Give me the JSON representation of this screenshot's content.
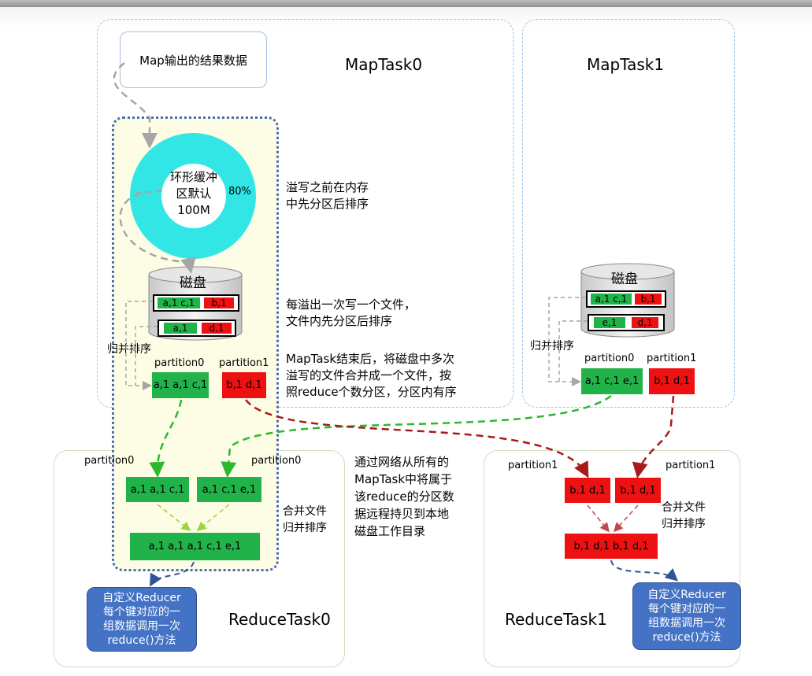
{
  "maptask0": {
    "title": "MapTask0",
    "map_output": "Map输出的结果数据",
    "ring_buffer": [
      "环形缓冲",
      "区默认",
      "100M"
    ],
    "percent": "80%",
    "spill_note": [
      "溢写之前在内存",
      "中先分区后排序"
    ],
    "disk_label": "磁盘",
    "spill_file_note": [
      "每溢出一次写一个文件，",
      "文件内先分区后排序"
    ],
    "spill1": {
      "green": "a,1 c,1",
      "red": "b,1"
    },
    "spill2": {
      "green": "a,1",
      "red": "d,1"
    },
    "merge_label": "归并排序",
    "merge_note": [
      "MapTask结束后，将磁盘中多次",
      "溢写的文件合并成一个文件，按",
      "照reduce个数分区，分区内有序"
    ],
    "p0_label": "partition0",
    "p1_label": "partition1",
    "p0_value": "a,1 a,1 c,1",
    "p1_value": "b,1 d,1"
  },
  "maptask1": {
    "title": "MapTask1",
    "disk_label": "磁盘",
    "spill1": {
      "green": "a,1 c,1",
      "red": "b,1"
    },
    "spill2": {
      "green": "e,1",
      "red": "d,1"
    },
    "merge_label": "归并排序",
    "p0_label": "partition0",
    "p1_label": "partition1",
    "p0_value": "a,1 c,1 e,1",
    "p1_value": "b,1 d,1"
  },
  "copy_note": [
    "通过网络从所有的",
    "MapTask中将属于",
    "该reduce的分区数",
    "据远程持贝到本地",
    "磁盘工作目录"
  ],
  "reducetask0": {
    "title": "ReduceTask0",
    "p_left_label": "partition0",
    "p_right_label": "partition0",
    "box_left": "a,1 a,1 c,1",
    "box_right": "a,1 c,1 e,1",
    "merged": "a,1 a,1 a,1 c,1 e,1",
    "merge_note": [
      "合并文件",
      "归并排序"
    ],
    "reducer": [
      "自定义Reducer",
      "每个键对应的一",
      "组数据调用一次",
      "reduce()方法"
    ]
  },
  "reducetask1": {
    "title": "ReduceTask1",
    "p_left_label": "partition1",
    "p_right_label": "partition1",
    "box_left": "b,1 d,1",
    "box_right": "b,1 d,1",
    "merged": "b,1 d,1 b,1 d,1",
    "merge_note": [
      "合并文件",
      "归并排序"
    ],
    "reducer": [
      "自定义Reducer",
      "每个键对应的一",
      "组数据调用一次",
      "reduce()方法"
    ]
  },
  "colors": {
    "green": "#21b24a",
    "red": "#ee1111",
    "cyan": "#33e6e6",
    "reducer_blue": "#4472c4",
    "arrow_gray": "#a6a6a6",
    "arrow_green": "#2eb82e",
    "arrow_darkred": "#a81b1b",
    "arrow_blue": "#2f5597"
  }
}
